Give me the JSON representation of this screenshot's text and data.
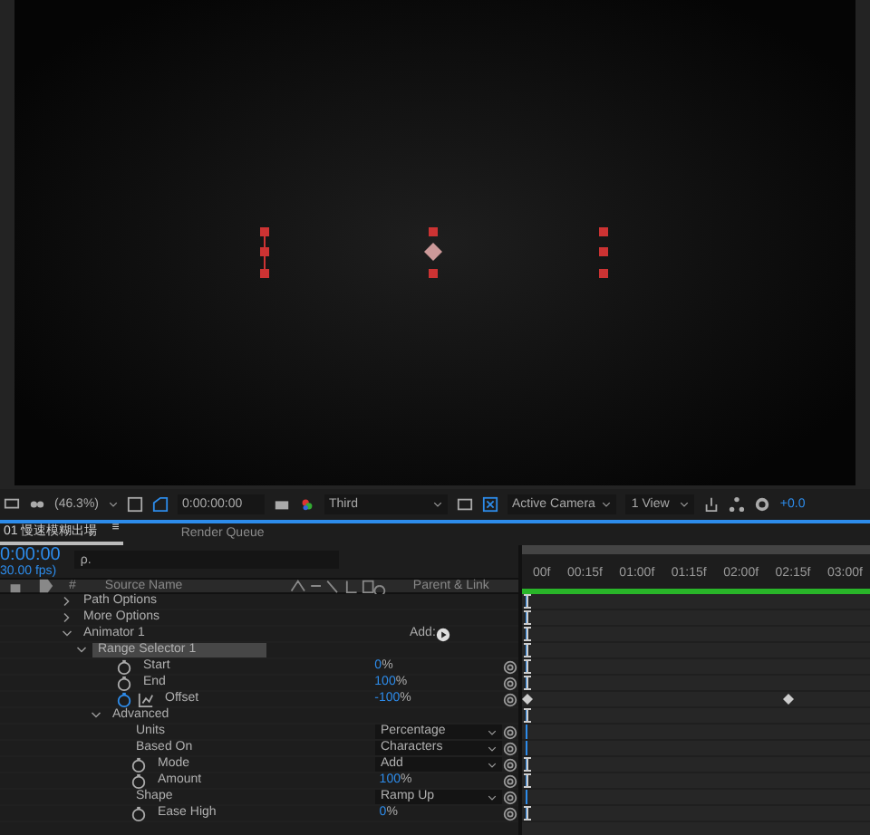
{
  "viewer": {
    "zoom": "(46.3%)",
    "timecode": "0:00:00:00",
    "resolution": "Third",
    "camera": "Active Camera",
    "views": "1 View",
    "exposure": "+0.0"
  },
  "tabs": [
    {
      "label": "01 慢速模糊出場",
      "selected": true,
      "menu": "≡"
    },
    {
      "label": "Render Queue",
      "selected": false
    }
  ],
  "time": {
    "current": "0:00:00",
    "fps": "30.00 fps)",
    "search_placeholder": "ρ."
  },
  "columns": {
    "number": "#",
    "source_name": "Source Name",
    "parent": "Parent & Link"
  },
  "ruler": [
    "00f",
    "00:15f",
    "01:00f",
    "01:15f",
    "02:00f",
    "02:15f",
    "03:00f"
  ],
  "layers": [
    {
      "label": "Path Options",
      "expanded": false,
      "marker": true
    },
    {
      "label": "More Options",
      "expanded": false,
      "marker": true
    },
    {
      "label": "Animator 1",
      "expanded": true,
      "add": "Add:",
      "marker": true,
      "children": [
        {
          "label": "Range Selector 1",
          "expanded": true,
          "selected": true,
          "marker": true,
          "children": [
            {
              "label": "Start",
              "kind": "number",
              "value": "0",
              "unit": "%",
              "stopwatch": false,
              "marker": true
            },
            {
              "label": "End",
              "kind": "number",
              "value": "100",
              "unit": "%",
              "stopwatch": false,
              "marker": true
            },
            {
              "label": "Offset",
              "kind": "number",
              "value": "-100",
              "unit": "%",
              "stopwatch": true,
              "marker": false
            },
            {
              "label": "Advanced",
              "expanded": true,
              "marker": true,
              "children": [
                {
                  "label": "Units",
                  "kind": "dropdown",
                  "value": "Percentage",
                  "marker": false
                },
                {
                  "label": "Based On",
                  "kind": "dropdown",
                  "value": "Characters",
                  "marker": false
                },
                {
                  "label": "Mode",
                  "kind": "dropdown",
                  "value": "Add",
                  "stopwatch": false,
                  "marker": true
                },
                {
                  "label": "Amount",
                  "kind": "number",
                  "value": "100",
                  "unit": "%",
                  "stopwatch": false,
                  "marker": true
                },
                {
                  "label": "Shape",
                  "kind": "dropdown",
                  "value": "Ramp Up",
                  "marker": false
                },
                {
                  "label": "Ease High",
                  "kind": "number",
                  "value": "0",
                  "unit": "%",
                  "stopwatch": false,
                  "marker": true
                }
              ]
            }
          ]
        }
      ]
    }
  ]
}
